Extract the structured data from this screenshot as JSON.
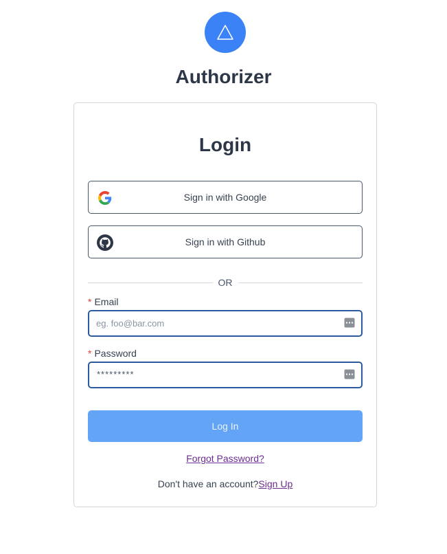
{
  "app": {
    "title": "Authorizer",
    "logo_icon": "triangle-icon"
  },
  "colors": {
    "accent": "#3b82f6",
    "login_button": "#63a4f7",
    "link": "#6b2d8f",
    "required": "#e53e3e"
  },
  "login": {
    "title": "Login",
    "google_label": "Sign in with Google",
    "google_icon": "google-icon",
    "github_label": "Sign in with Github",
    "github_icon": "github-icon",
    "divider_text": "OR",
    "email": {
      "required_mark": "*",
      "label": "Email",
      "placeholder": "eg. foo@bar.com",
      "value": ""
    },
    "password": {
      "required_mark": "*",
      "label": "Password",
      "masked_value": "*********"
    },
    "submit_label": "Log In",
    "forgot_label": "Forgot Password?",
    "signup_prompt": "Don't have an account?",
    "signup_label": "Sign Up"
  }
}
